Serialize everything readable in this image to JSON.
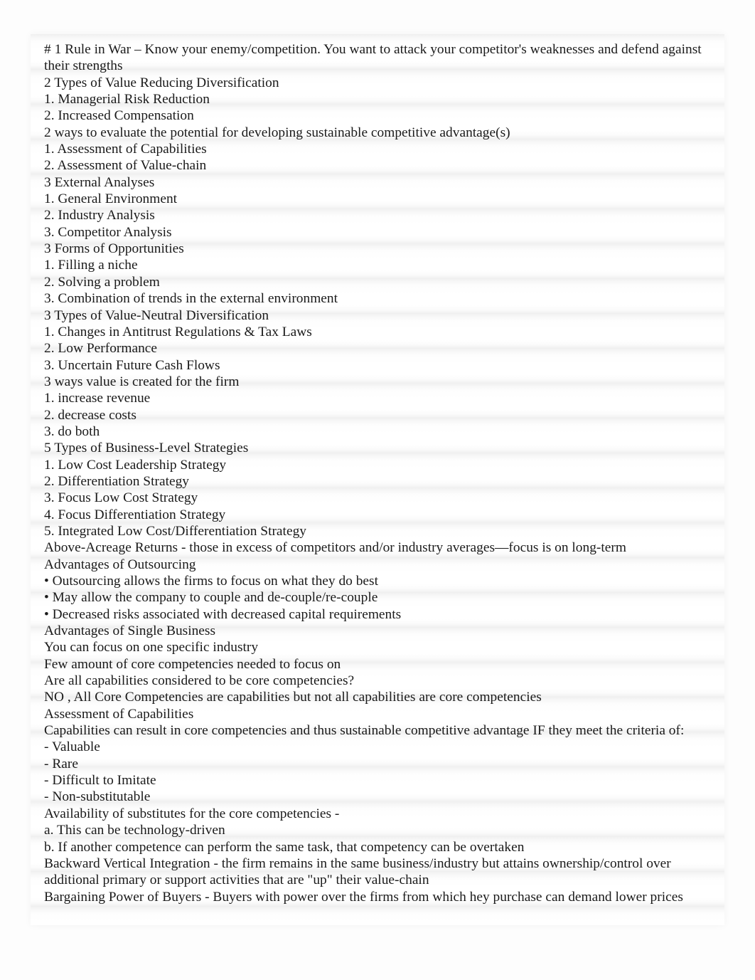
{
  "document": {
    "background_color": "#ffffff",
    "page_color": "#fdfdfd",
    "text_color": "#1a1a1a",
    "band_color": "#f0f0f0",
    "lines": [
      "# 1 Rule in War – Know your enemy/competition.   You want to attack your competitor's weaknesses and defend against their strengths",
      "2 Types of Value Reducing Diversification",
      "1. Managerial Risk Reduction",
      "2. Increased Compensation",
      "2 ways to evaluate the potential for developing sustainable competitive advantage(s)",
      "1. Assessment of Capabilities",
      "2. Assessment of Value-chain",
      "3 External Analyses",
      "1. General Environment",
      "2. Industry Analysis",
      "3. Competitor Analysis",
      "3 Forms of Opportunities",
      "1. Filling a niche",
      "2. Solving a problem",
      "3. Combination of trends in the external environment",
      "3 Types of Value-Neutral Diversification",
      "1. Changes in Antitrust Regulations & Tax Laws",
      "2. Low Performance",
      "3. Uncertain Future Cash Flows",
      "3 ways value is created for the firm",
      "1. increase revenue",
      "2. decrease costs",
      "3. do both",
      "5 Types of Business-Level Strategies",
      "1. Low Cost Leadership Strategy",
      "2. Differentiation Strategy",
      "3. Focus Low Cost Strategy",
      "4. Focus Differentiation Strategy",
      "5. Integrated Low Cost/Differentiation Strategy",
      "Above-Acreage Returns - those in excess of competitors and/or industry averages—focus is on long-term",
      "Advantages of Outsourcing",
      "• Outsourcing allows the firms to focus on what they do best",
      "• May allow the company to couple and de-couple/re-couple",
      "• Decreased risks associated with decreased capital requirements",
      "Advantages of Single Business",
      "You can focus on one specific industry",
      "Few amount of core competencies needed to focus on",
      "Are all capabilities considered to be core competencies?",
      "NO , All Core Competencies are capabilities but not all capabilities are core competencies",
      "Assessment of Capabilities",
      "Capabilities can result in core competencies and thus sustainable competitive advantage IF they meet the criteria of:",
      "- Valuable",
      "- Rare",
      "- Difficult to Imitate",
      "- Non-substitutable",
      "Availability of substitutes for the core competencies -",
      "a. This can be technology-driven",
      "b. If another competence can perform the same task, that competency can be overtaken",
      "Backward Vertical Integration -  the firm remains in the same business/industry but attains ownership/control over additional primary or support activities that are \"up\" their value-chain",
      "Bargaining Power of Buyers - Buyers with power over the firms from which hey purchase can demand lower prices"
    ]
  }
}
